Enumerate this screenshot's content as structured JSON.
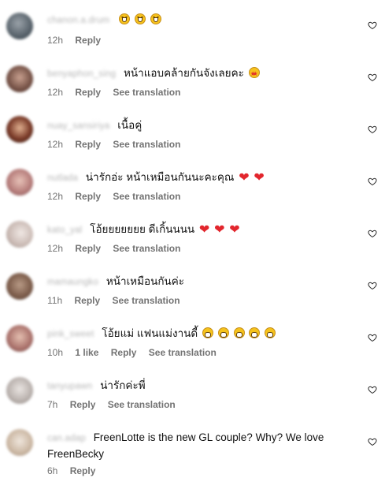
{
  "comments": [
    {
      "user": "chanon.a.drum",
      "text": "",
      "emojis": [
        "laugh",
        "laugh",
        "laugh"
      ],
      "time": "12h",
      "likes": "",
      "reply": "Reply",
      "translate": ""
    },
    {
      "user": "benyaphon_sing",
      "text": "หน้าแอบคล้ายกันจังเลยคะ",
      "emojis": [
        "starstruck"
      ],
      "time": "12h",
      "likes": "",
      "reply": "Reply",
      "translate": "See translation"
    },
    {
      "user": "nuay_sansiriya",
      "text": "เนื้อคู่",
      "emojis": [],
      "time": "12h",
      "likes": "",
      "reply": "Reply",
      "translate": "See translation"
    },
    {
      "user": "nutlada",
      "text": "น่ารักอ่ะ หน้าเหมือนกันนะคะคุณ",
      "emojis": [
        "heart",
        "heart"
      ],
      "time": "12h",
      "likes": "",
      "reply": "Reply",
      "translate": "See translation"
    },
    {
      "user": "kato_yal",
      "text": "โอ้ยยยยยยย ดีเกิ้นนนน",
      "emojis": [
        "heart",
        "heart",
        "heart"
      ],
      "time": "12h",
      "likes": "",
      "reply": "Reply",
      "translate": "See translation"
    },
    {
      "user": "mamaungko",
      "text": "หน้าเหมือนกันค่ะ",
      "emojis": [],
      "time": "11h",
      "likes": "",
      "reply": "Reply",
      "translate": "See translation"
    },
    {
      "user": "pink_sweet",
      "text": "โอ้ยแม่ แฟนแม่งานดี้",
      "emojis": [
        "grin",
        "grin",
        "grin",
        "grin",
        "grin"
      ],
      "time": "10h",
      "likes": "1 like",
      "reply": "Reply",
      "translate": "See translation"
    },
    {
      "user": "tanyupawn",
      "text": "น่ารักค่ะพี่",
      "emojis": [],
      "time": "7h",
      "likes": "",
      "reply": "Reply",
      "translate": "See translation"
    },
    {
      "user": "can.adap",
      "text": "FreenLotte is the new GL couple? Why? We love FreenBecky",
      "emojis": [],
      "time": "6h",
      "likes": "",
      "reply": "Reply",
      "translate": ""
    }
  ],
  "colors": {
    "muted": "#737373",
    "heart": "#e2262d",
    "text": "#111111"
  }
}
